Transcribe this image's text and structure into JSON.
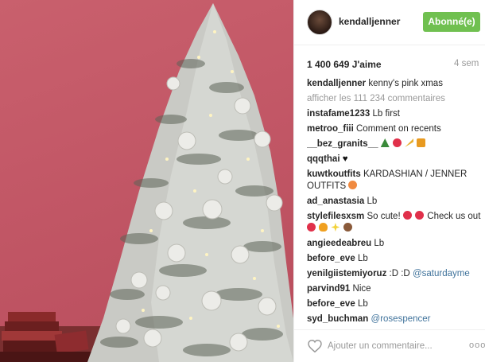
{
  "post": {
    "username": "kendalljenner",
    "follow_label": "Abonné(e)",
    "likes": "1 400 649 J'aime",
    "time": "4 sem",
    "caption_user": "kendalljenner",
    "caption_text": "kenny's pink xmas",
    "show_all": "afficher les 111 234 commentaires",
    "add_comment_placeholder": "Ajouter un commentaire...",
    "more_label": "ooo"
  },
  "comments": [
    {
      "user": "instafame1233",
      "text": "Lb first"
    },
    {
      "user": "metroo_fiii",
      "text": "Comment on recents"
    },
    {
      "user": "__bez_granits__",
      "text": "",
      "emojis": [
        "tree-emoji",
        "hearts-emoji",
        "party-emoji",
        "gift-emoji"
      ]
    },
    {
      "user": "qqqthai",
      "text": "",
      "emojis": [
        "black-heart-emoji"
      ]
    },
    {
      "user": "kuwtkoutfits",
      "text": "KARDASHIAN / JENNER OUTFITS",
      "emojis": [
        "peach-emoji"
      ]
    },
    {
      "user": "ad_anastasia",
      "text": "Lb"
    },
    {
      "user": "stylefilesxsm",
      "text": "So cute!",
      "text2": "Check us out",
      "emojis": [
        "heart-eyes-emoji",
        "heart-eyes-emoji"
      ],
      "emojis2": [
        "heart-eyes-emoji",
        "fire-emoji",
        "sparkles-emoji",
        "monkey-emoji"
      ]
    },
    {
      "user": "angieedeabreu",
      "text": "Lb"
    },
    {
      "user": "before_eve",
      "text": "Lb"
    },
    {
      "user": "yenilgiistemiyoruz",
      "text": ":D :D",
      "mention": "@saturdayme"
    },
    {
      "user": "parvind91",
      "text": "Nice"
    },
    {
      "user": "before_eve",
      "text": "Lb"
    },
    {
      "user": "syd_buchman",
      "text": "",
      "mention": "@rosespencer"
    }
  ],
  "colors": {
    "follow": "#70c050",
    "wall": "#c25766",
    "mention": "#3f729b"
  }
}
